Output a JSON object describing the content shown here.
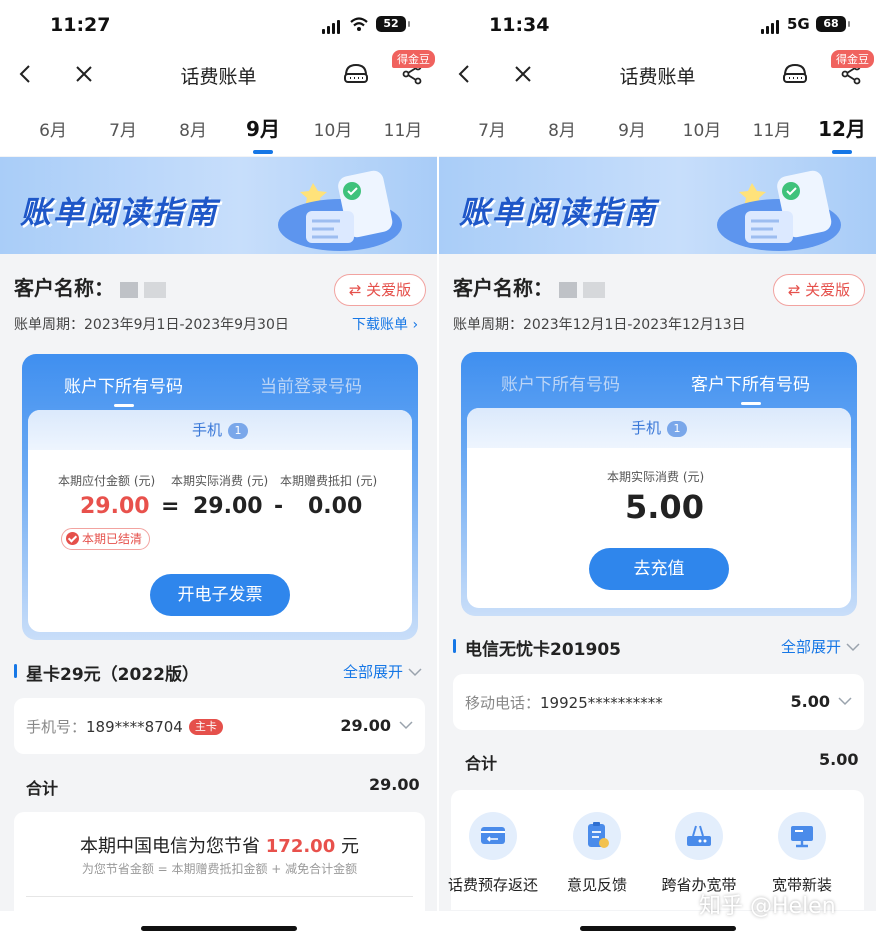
{
  "left": {
    "status": {
      "time": "11:27",
      "battery": "52"
    },
    "nav": {
      "title": "话费账单",
      "reward_badge": "得金豆"
    },
    "months": [
      "6月",
      "7月",
      "8月",
      "9月",
      "10月",
      "11月"
    ],
    "active_month": "9月",
    "banner": "账单阅读指南",
    "customer_label": "客户名称：",
    "care_button": "⇄ 关爱版",
    "period": "账单周期：2023年9月1日-2023年9月30日",
    "download": "下载账单 ›",
    "tabs": {
      "active": "账户下所有号码",
      "inactive": "当前登录号码"
    },
    "phone_count_label": "手机",
    "phone_count": "1",
    "amounts": {
      "due_label": "本期应付金额 (元)",
      "due": "29.00",
      "eq": "=",
      "actual_label": "本期实际消费 (元)",
      "actual": "29.00",
      "minus": "-",
      "gift_label": "本期赠费抵扣 (元)",
      "gift": "0.00"
    },
    "settled": "本期已结清",
    "invoice_button": "开电子发票",
    "plan_title": "星卡29元（2022版）",
    "expand_all": "全部展开",
    "line": {
      "label": "手机号：",
      "number": "189****8704",
      "badge": "主卡",
      "amount": "29.00"
    },
    "total_label": "合计",
    "total": "29.00",
    "save": {
      "prefix": "本期中国电信为您节省",
      "amount": "172.00",
      "suffix": "元",
      "sub": "为您节省金额 = 本期赠费抵扣金额 + 减免合计金额"
    }
  },
  "right": {
    "status": {
      "time": "11:34",
      "network": "5G",
      "battery": "68"
    },
    "nav": {
      "title": "话费账单",
      "reward_badge": "得金豆"
    },
    "months": [
      "7月",
      "8月",
      "9月",
      "10月",
      "11月",
      "12月"
    ],
    "active_month": "12月",
    "banner": "账单阅读指南",
    "customer_label": "客户名称：",
    "care_button": "⇄ 关爱版",
    "period": "账单周期：2023年12月1日-2023年12月13日",
    "tabs": {
      "inactive": "账户下所有号码",
      "active": "客户下所有号码"
    },
    "phone_count_label": "手机",
    "phone_count": "1",
    "actual_label": "本期实际消费 (元)",
    "actual": "5.00",
    "recharge_button": "去充值",
    "plan_title": "电信无忧卡201905",
    "expand_all": "全部展开",
    "line": {
      "label": "移动电话：",
      "number": "19925**********",
      "amount": "5.00"
    },
    "total_label": "合计",
    "total": "5.00",
    "services": [
      "话费预存返还",
      "意见反馈",
      "跨省办宽带",
      "宽带新装"
    ],
    "watermark": "知乎 @Helen"
  },
  "colors": {
    "accent": "#1677e6",
    "red": "#e8514c",
    "card_blue": "#3f8ff0"
  }
}
